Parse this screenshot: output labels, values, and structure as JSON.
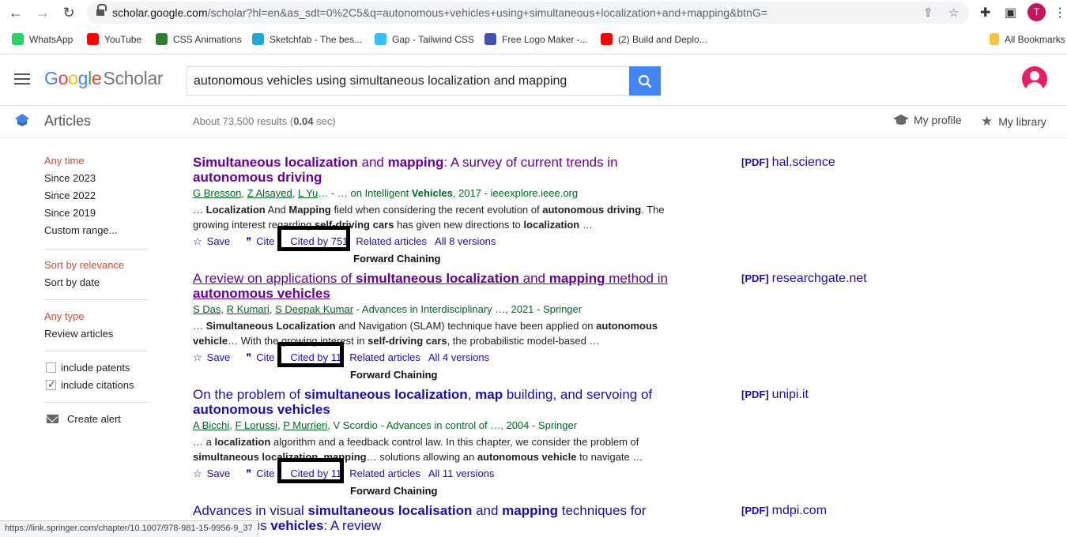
{
  "browser": {
    "url_host": "scholar.google.com",
    "url_path": "/scholar?hl=en&as_sdt=0%2C5&q=autonomous+vehicles+using+simultaneous+localization+and+mapping&btnG=",
    "profile_initial": "T",
    "bookmarks": [
      {
        "label": "WhatsApp",
        "color": "#25d366"
      },
      {
        "label": "YouTube",
        "color": "#ff0000"
      },
      {
        "label": "CSS Animations",
        "color": "#2e7d32"
      },
      {
        "label": "Sketchfab - The bes...",
        "color": "#1caad9"
      },
      {
        "label": "Gap - Tailwind CSS",
        "color": "#38bdf8"
      },
      {
        "label": "Free Logo Maker -...",
        "color": "#3f51b5"
      },
      {
        "label": "(2) Build and Deplo...",
        "color": "#ff0000"
      }
    ],
    "all_bookmarks": "All Bookmarks",
    "status_url": "https://link.springer.com/chapter/10.1007/978-981-15-9956-9_37"
  },
  "header": {
    "logo_google": [
      "G",
      "o",
      "o",
      "g",
      "l",
      "e"
    ],
    "logo_scholar": "Scholar",
    "search_value": "autonomous vehicles using simultaneous localization and mapping"
  },
  "subbar": {
    "section": "Articles",
    "stats_prefix": "About 73,500 results (",
    "stats_time": "0.04",
    "stats_suffix": " sec)",
    "my_profile": "My profile",
    "my_library": "My library"
  },
  "sidebar": {
    "time": {
      "active": "Any time",
      "options": [
        "Since 2023",
        "Since 2022",
        "Since 2019",
        "Custom range..."
      ]
    },
    "sort": {
      "active": "Sort by relevance",
      "options": [
        "Sort by date"
      ]
    },
    "type": {
      "active": "Any type",
      "options": [
        "Review articles"
      ]
    },
    "include_patents": "include patents",
    "include_citations": "include citations",
    "create_alert": "Create alert"
  },
  "results": [
    {
      "title_parts": [
        [
          "b",
          "Simultaneous localization"
        ],
        [
          "t",
          " and "
        ],
        [
          "b",
          "mapping"
        ],
        [
          "t",
          ": A survey of current trends in "
        ],
        [
          "b",
          "autonomous driving"
        ]
      ],
      "visited": true,
      "authors": [
        [
          "u",
          "G Bresson"
        ],
        [
          "t",
          ", "
        ],
        [
          "u",
          "Z Alsayed"
        ],
        [
          "t",
          ", "
        ],
        [
          "u",
          "L Yu"
        ],
        [
          "t",
          "… - … on Intelligent "
        ],
        [
          "b",
          "Vehicles"
        ],
        [
          "t",
          ", 2017 - ieeexplore.ieee.org"
        ]
      ],
      "snippet": [
        [
          "t",
          "… "
        ],
        [
          "b",
          "Localization"
        ],
        [
          "t",
          " And "
        ],
        [
          "b",
          "Mapping"
        ],
        [
          "t",
          " field when considering the recent evolution of "
        ],
        [
          "b",
          "autonomous driving"
        ],
        [
          "t",
          ". The growing interest regarding "
        ],
        [
          "b",
          "self-driving cars"
        ],
        [
          "t",
          " has given new directions to "
        ],
        [
          "b",
          "localization"
        ],
        [
          "t",
          " …"
        ]
      ],
      "save": "Save",
      "cite": "Cite",
      "cited_by": "Cited by 751",
      "related": "Related articles",
      "versions": "All 8 versions",
      "annotation": "Forward Chaining",
      "pdf_tag": "[PDF]",
      "pdf_source": "hal.science"
    },
    {
      "title_parts": [
        [
          "t",
          "A review on applications of "
        ],
        [
          "b",
          "simultaneous localization"
        ],
        [
          "t",
          " and "
        ],
        [
          "b",
          "mapping"
        ],
        [
          "t",
          " method in "
        ],
        [
          "b",
          "autonomous vehicles"
        ]
      ],
      "visited": true,
      "authors": [
        [
          "u",
          "S Das"
        ],
        [
          "t",
          ", "
        ],
        [
          "u",
          "R Kumari"
        ],
        [
          "t",
          ", "
        ],
        [
          "u",
          "S Deepak Kumar"
        ],
        [
          "t",
          " - Advances in Interdisciplinary …, 2021 - Springer"
        ]
      ],
      "snippet": [
        [
          "t",
          "… "
        ],
        [
          "b",
          "Simultaneous Localization"
        ],
        [
          "t",
          " and Navigation (SLAM) technique have been applied on "
        ],
        [
          "b",
          "autonomous vehicle"
        ],
        [
          "t",
          "… With the growing interest in "
        ],
        [
          "b",
          "self-driving cars"
        ],
        [
          "t",
          ", the probabilistic model-based …"
        ]
      ],
      "save": "Save",
      "cite": "Cite",
      "cited_by": "Cited by 11",
      "related": "Related articles",
      "versions": "All 4 versions",
      "annotation": "Forward Chaining",
      "pdf_tag": "[PDF]",
      "pdf_source": "researchgate.net"
    },
    {
      "title_parts": [
        [
          "t",
          "On the problem of "
        ],
        [
          "b",
          "simultaneous localization"
        ],
        [
          "t",
          ", "
        ],
        [
          "b",
          "map"
        ],
        [
          "t",
          " building, and servoing of "
        ],
        [
          "b",
          "autonomous vehicles"
        ]
      ],
      "visited": false,
      "authors": [
        [
          "u",
          "A Bicchi"
        ],
        [
          "t",
          ", "
        ],
        [
          "u",
          "F Lorussi"
        ],
        [
          "t",
          ", "
        ],
        [
          "u",
          "P Murrieri"
        ],
        [
          "t",
          ", V Scordio - Advances in control of …, 2004 - Springer"
        ]
      ],
      "snippet": [
        [
          "t",
          "… a "
        ],
        [
          "b",
          "localization"
        ],
        [
          "t",
          " algorithm and a feedback control law. In this chapter, we consider the problem of "
        ],
        [
          "b",
          "simultaneous localization"
        ],
        [
          "t",
          ", "
        ],
        [
          "b",
          "mapping"
        ],
        [
          "t",
          "… solutions allowing an "
        ],
        [
          "b",
          "autonomous vehicle"
        ],
        [
          "t",
          " to navigate …"
        ]
      ],
      "save": "Save",
      "cite": "Cite",
      "cited_by": "Cited by 11",
      "related": "Related articles",
      "versions": "All 11 versions",
      "annotation": "Forward Chaining",
      "pdf_tag": "[PDF]",
      "pdf_source": "unipi.it"
    },
    {
      "title_parts": [
        [
          "t",
          "Advances in visual "
        ],
        [
          "b",
          "simultaneous localisation"
        ],
        [
          "t",
          " and "
        ],
        [
          "b",
          "mapping"
        ],
        [
          "t",
          " techniques for autonomous "
        ],
        [
          "b",
          "vehicles"
        ],
        [
          "t",
          ": A review"
        ]
      ],
      "visited": false,
      "pdf_tag": "[PDF]",
      "pdf_source": "mdpi.com"
    }
  ],
  "colors": {
    "link": "#1a0dab",
    "visited": "#660099",
    "author_green": "#006621",
    "sidebar_red": "#d14836",
    "search_blue": "#4285f4"
  }
}
